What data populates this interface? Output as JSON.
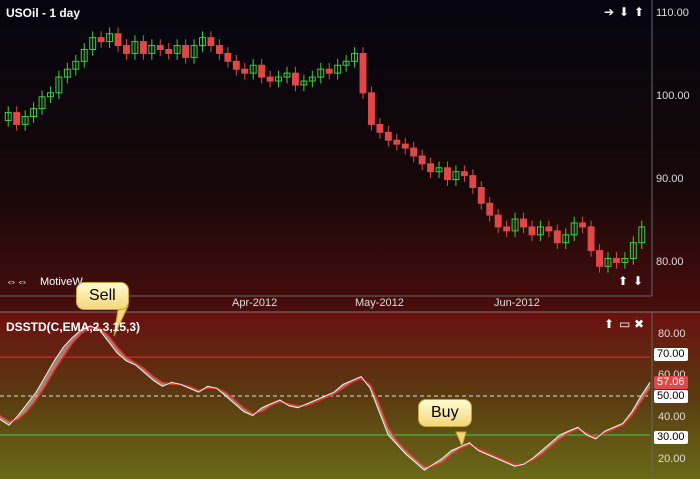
{
  "price_panel": {
    "title": "USOil - 1 day",
    "motive_label": "MotiveW",
    "y_ticks": [
      "110.00",
      "100.00",
      "90.00",
      "80.00"
    ],
    "x_ticks": [
      "Apr-2012",
      "May-2012",
      "Jun-2012"
    ]
  },
  "indicator_panel": {
    "title": "DSSTD(C,EMA,2,3,15,3)",
    "y_ticks": [
      "80.00",
      "70.00",
      "60.00",
      "57.06",
      "50.00",
      "40.00",
      "30.00",
      "20.00"
    ],
    "sell_label": "Sell",
    "buy_label": "Buy"
  },
  "colors": {
    "up": "#3ecf3e",
    "down": "#e04848",
    "upper_line": "#e03030",
    "lower_line": "#40d040",
    "mid_line": "#dddddd",
    "value_tag": "#e04848"
  },
  "icons": [
    "arrow-right-icon",
    "arrow-down-icon",
    "arrow-up-icon",
    "arrow-left-right-icon",
    "restore-icon",
    "close-icon"
  ],
  "chart_data": [
    {
      "type": "candlestick",
      "title": "USOil - 1 day",
      "ylim": [
        76,
        111
      ],
      "x_ticks": [
        "Apr-2012",
        "May-2012",
        "Jun-2012"
      ],
      "close": [
        98.5,
        97,
        98,
        99,
        100.5,
        101,
        103,
        104,
        105,
        106.5,
        108,
        107.5,
        108.5,
        107,
        106,
        107.5,
        106,
        107,
        106.5,
        106,
        107,
        105.5,
        107,
        108,
        107,
        106,
        105,
        104,
        103.5,
        104.5,
        103,
        102.5,
        103,
        103.5,
        102,
        102.5,
        103,
        104,
        103.5,
        104.5,
        105,
        106,
        101,
        97,
        96,
        95,
        94.5,
        94,
        93,
        92,
        91,
        91.5,
        90,
        91,
        90.5,
        89,
        87,
        85.5,
        84,
        83.5,
        85,
        84,
        83,
        84,
        83.5,
        82,
        83,
        84.5,
        84,
        81,
        79,
        80,
        79.5,
        80,
        82,
        84
      ],
      "open": [
        97.5,
        98.5,
        97,
        98,
        99,
        100.5,
        101,
        103,
        104,
        105,
        106.5,
        108,
        107.5,
        108.5,
        107,
        106,
        107.5,
        106,
        107,
        106.5,
        106,
        107,
        105.5,
        107,
        108,
        107,
        106,
        105,
        104,
        103.5,
        104.5,
        103,
        102.5,
        103,
        103.5,
        102,
        102.5,
        103,
        104,
        103.5,
        104.5,
        105,
        106,
        101,
        97,
        96,
        95,
        94.5,
        94,
        93,
        92,
        91,
        91.5,
        90,
        91,
        90.5,
        89,
        87,
        85.5,
        84,
        83.5,
        85,
        84,
        83,
        84,
        83.5,
        82,
        83,
        84.5,
        84,
        81,
        79,
        80,
        79.5,
        80,
        82
      ]
    },
    {
      "type": "area",
      "title": "DSSTD(C,EMA,2,3,15,3)",
      "ylim": [
        10,
        88
      ],
      "reference_lines": [
        70,
        50,
        30
      ],
      "last_value": 57.06,
      "series": [
        {
          "values": [
            38,
            35,
            40,
            46,
            52,
            60,
            68,
            75,
            80,
            84,
            86,
            84,
            78,
            72,
            68,
            66,
            62,
            58,
            55,
            57,
            56,
            54,
            52,
            55,
            54,
            50,
            46,
            42,
            40,
            44,
            46,
            48,
            45,
            44,
            46,
            48,
            50,
            52,
            56,
            58,
            60,
            54,
            42,
            30,
            25,
            20,
            16,
            12,
            15,
            18,
            22,
            24,
            26,
            22,
            20,
            18,
            16,
            14,
            15,
            18,
            22,
            26,
            30,
            32,
            34,
            30,
            28,
            32,
            34,
            36,
            42,
            50,
            57
          ]
        },
        {
          "values": [
            40,
            37,
            38,
            42,
            48,
            55,
            63,
            70,
            77,
            82,
            85,
            85,
            81,
            75,
            70,
            67,
            64,
            60,
            57,
            56,
            56,
            55,
            53,
            54,
            54,
            52,
            48,
            44,
            41,
            42,
            45,
            47,
            46,
            45,
            45,
            47,
            49,
            51,
            54,
            57,
            59,
            56,
            46,
            34,
            27,
            22,
            18,
            14,
            14,
            16,
            20,
            23,
            25,
            23,
            21,
            19,
            17,
            15,
            15,
            17,
            20,
            24,
            28,
            31,
            33,
            31,
            29,
            31,
            33,
            35,
            40,
            47,
            54
          ]
        }
      ]
    }
  ]
}
